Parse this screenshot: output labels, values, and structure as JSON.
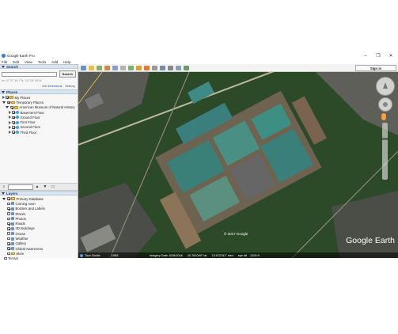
{
  "window": {
    "title": "Google Earth Pro",
    "controls": {
      "minimize": "–",
      "restore": "❐",
      "close": "✕"
    }
  },
  "menu": [
    "File",
    "Edit",
    "View",
    "Tools",
    "Add",
    "Help"
  ],
  "search": {
    "header": "Search",
    "input_value": "",
    "button_label": "Search",
    "hint": "ex: 37 07' 16.7\"N, 122 03' 06\"W",
    "get_directions": "Get Directions",
    "history": "History"
  },
  "places": {
    "header": "Places",
    "items": [
      {
        "label": "My Places",
        "checked": true
      },
      {
        "label": "Temporary Places",
        "checked": true
      },
      {
        "label": "American Museum of Natural History",
        "checked": true
      },
      {
        "label": "Basement Floor",
        "checked": true
      },
      {
        "label": "Ground Floor",
        "checked": true
      },
      {
        "label": "First Floor",
        "checked": true
      },
      {
        "label": "Second Floor",
        "checked": true
      },
      {
        "label": "Third Floor",
        "checked": true
      }
    ]
  },
  "layers": {
    "header": "Layers",
    "items": [
      {
        "label": "Primary Database",
        "checked": true
      },
      {
        "label": "Coming soon",
        "checked": false
      },
      {
        "label": "Borders and Labels",
        "checked": true
      },
      {
        "label": "Places",
        "checked": false
      },
      {
        "label": "Photos",
        "checked": false
      },
      {
        "label": "Roads",
        "checked": true
      },
      {
        "label": "3D Buildings",
        "checked": true
      },
      {
        "label": "Ocean",
        "checked": false
      },
      {
        "label": "Weather",
        "checked": false
      },
      {
        "label": "Gallery",
        "checked": true
      },
      {
        "label": "Global Awareness",
        "checked": true
      },
      {
        "label": "More",
        "checked": false
      },
      {
        "label": "Terrain",
        "checked": false
      }
    ]
  },
  "toolbar": {
    "sign_in": "Sign in"
  },
  "map": {
    "copyright": "© 2017 Google",
    "logo": "Google Earth",
    "tour_guide": "Tour Guide",
    "year": "1995",
    "status": {
      "imagery_date": "Imagery Date: 6/26/2016",
      "lat": "40.781099° lat",
      "lon": "73.972761° elev",
      "eye_alt": "eye alt",
      "eye_alt_value": "1205 ft"
    }
  },
  "colors": {
    "panel_header": "#d9e4ef",
    "accent": "#2a4f8f",
    "roof_teal": "#3d8f84",
    "tree_green": "#2d4a28"
  }
}
